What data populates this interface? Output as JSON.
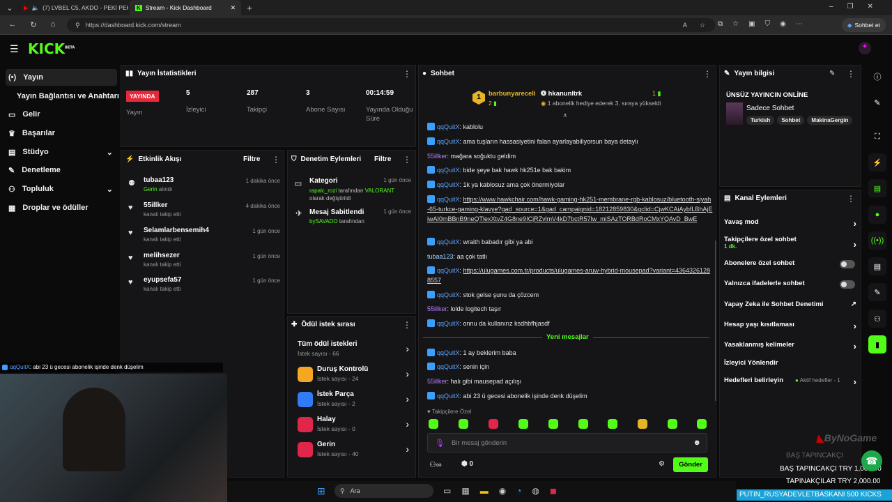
{
  "browser": {
    "tab1_title": "(7) LVBEL C5, AKDO - PEKİ PEKİ",
    "tab2_title": "Stream - Kick Dashboard",
    "url": "https://dashboard.kick.com/stream",
    "copilot_label": "Sohbet et"
  },
  "header": {
    "logo": "KICK",
    "beta": "BETA"
  },
  "sidebar": {
    "items": [
      {
        "label": "Yayın"
      },
      {
        "label": "Yayın Bağlantısı ve Anahtarı"
      },
      {
        "label": "Gelir"
      },
      {
        "label": "Başarılar"
      },
      {
        "label": "Stüdyo"
      },
      {
        "label": "Denetleme"
      },
      {
        "label": "Topluluk"
      },
      {
        "label": "Droplar ve ödüller"
      }
    ]
  },
  "stats": {
    "title": "Yayın İstatistikleri",
    "live_badge": "YAYINDA",
    "live_label": "Yayın",
    "viewers": "5",
    "viewers_label": "İzleyici",
    "followers": "287",
    "followers_label": "Takipçi",
    "subs": "3",
    "subs_label": "Abone Sayısı",
    "uptime": "00:14:59",
    "uptime_label": "Yayında Olduğu Süre"
  },
  "activity": {
    "title": "Etkinlik Akışı",
    "filter": "Filtre",
    "events": [
      {
        "name": "tubaa123",
        "action": "Gerin",
        "suffix": " alındı",
        "time": "1 dakika önce"
      },
      {
        "name": "55illker",
        "action": "kanalı takip etti",
        "suffix": "",
        "time": "4 dakika önce"
      },
      {
        "name": "Selamlarbensemih4",
        "action": "kanalı takip etti",
        "suffix": "",
        "time": "1 gün önce"
      },
      {
        "name": "melihsezer",
        "action": "kanalı takip etti",
        "suffix": "",
        "time": "1 gün önce"
      },
      {
        "name": "eyupsefa57",
        "action": "kanalı takip etti",
        "suffix": "",
        "time": "1 gün önce"
      }
    ]
  },
  "moderation": {
    "title": "Denetim Eylemleri",
    "filter": "Filtre",
    "items": [
      {
        "title": "Kategori",
        "user": "rapalc_rozi",
        "mid": " tarafından ",
        "value": "VALORANT",
        "rest": "olarak değiştirildi",
        "time": "1 gün önce"
      },
      {
        "title": "Mesaj Sabitlendi",
        "user": "bySAVADO",
        "mid": " tarafından",
        "value": "",
        "rest": "",
        "time": "1 gün önce"
      }
    ]
  },
  "rewards": {
    "title": "Ödül istek sırası",
    "items": [
      {
        "title": "Tüm ödül istekleri",
        "sub": "İstek sayısı - 66",
        "color": ""
      },
      {
        "title": "Duruş Kontrolü",
        "sub": "İstek sayısı - 24",
        "color": "#f5a623"
      },
      {
        "title": "İstek Parça",
        "sub": "İstek sayısı - 2",
        "color": "#2f7cf6"
      },
      {
        "title": "Halay",
        "sub": "İstek sayısı - 0",
        "color": "#e0264a"
      },
      {
        "title": "Gerin",
        "sub": "İstek sayısı - 40",
        "color": "#e0264a"
      }
    ]
  },
  "chat": {
    "title": "Sohbet",
    "top1_user": "barbunyareceli",
    "top1_count": "2",
    "top2_user": "hkanunltrk",
    "top2_count": "1",
    "top2_sub": "1 abonelik hediye ederek 3. sıraya yükseldi",
    "messages": [
      {
        "user": "qqQuitX",
        "text": "kablolu"
      },
      {
        "user": "qqQuitX",
        "text": "ama tuşların hassasiyetini falan ayarlayabiliyorsun baya detaylı"
      },
      {
        "user": "55illker",
        "text": "mağara soğuktu geldim"
      },
      {
        "user": "qqQuitX",
        "text": "bide şeye bak hawk hk251e bak bakim"
      },
      {
        "user": "qqQuitX",
        "text": "1k ya kablosuz ama çok önermiyolar"
      },
      {
        "user": "qqQuitX",
        "text": "https://www.hawkchair.com/hawk-gaming-hk251-membrane-rgb-kablosuz/bluetooth-siyah-65-turkce-gaming-klavye?gad_source=1&gad_campaignid=18212859830&gclid=CjwKCAiAybfLBhAjEiwAI0mBBnB9neQTlexXtvZ4G8ne9ICjRZvlmV4kD7bctR57lw_miSAzTORBdRoCMxYQAvD_BwE"
      },
      {
        "user": "qqQuitX",
        "text": "wraith babadır gibi ya abi"
      },
      {
        "user": "tubaa123",
        "text": "aa çok tatlı"
      },
      {
        "user": "qqQuitX",
        "text": "https://ulugames.com.tr/products/ulugames-aruw-hybrid-mousepad?variant=43643261288557"
      },
      {
        "user": "qqQuitX",
        "text": "stok gelse şunu da çözcem"
      },
      {
        "user": "55illker",
        "text": "lolde logitech taşır"
      },
      {
        "user": "qqQuitX",
        "text": "onnu da kullanırız ksdhbfhjasdf"
      }
    ],
    "new_divider": "Yeni mesajlar",
    "new_messages": [
      {
        "user": "qqQuitX",
        "text": "1 ay beklerim baba"
      },
      {
        "user": "qqQuitX",
        "text": "senin için"
      },
      {
        "user": "55illker",
        "text": "halı gibi mausepad açılışı"
      },
      {
        "user": "qqQuitX",
        "text": "abi 23 ü gecesi abonelik işinde denk düşelim"
      }
    ],
    "emote_label": "Takipçilere Özel",
    "input_placeholder": "Bir mesaj gönderin",
    "points": "0",
    "send": "Gönder"
  },
  "info": {
    "title": "Yayın bilgisi",
    "stream_title": "ÜNSÜZ YAYINCIN ONLİNE",
    "category": "Sadece Sohbet",
    "tags": [
      "Turkish",
      "Sohbet",
      "MakinaGergin"
    ]
  },
  "channel": {
    "title": "Kanal Eylemleri",
    "slow": "Yavaş mod",
    "followers_only": "Takipçilere özel sohbet",
    "followers_only_sub": "1 dk.",
    "subs_only": "Abonelere özel sohbet",
    "emotes_only": "Yalnızca ifadelerle sohbet",
    "ai_mod": "Yapay Zeka ile Sohbet Denetimi",
    "age": "Hesap yaşı kısıtlaması",
    "banned_words": "Yasaklanmış kelimeler",
    "redirect": "İzleyici Yönlendir",
    "goals": "Hedefleri belirleyin",
    "goals_sub": "Aktif hedefler - 1"
  },
  "overlay": {
    "pinned": "abi 23 ü gecesi abonelik işinde denk düşelim",
    "pinned_user": "qqQuitX",
    "search": "Ara",
    "brand": "ByNoGame",
    "line1": "BAŞ TAPINCAKÇI",
    "line1_amt": "TRY 1,000.00",
    "line2": "TAPINAKÇILAR",
    "line2_amt": "TRY 2,000.00",
    "ticker_user": "PUTIN_RUSYADEVLETBASKANI",
    "ticker_amt": "500 KICKS"
  }
}
